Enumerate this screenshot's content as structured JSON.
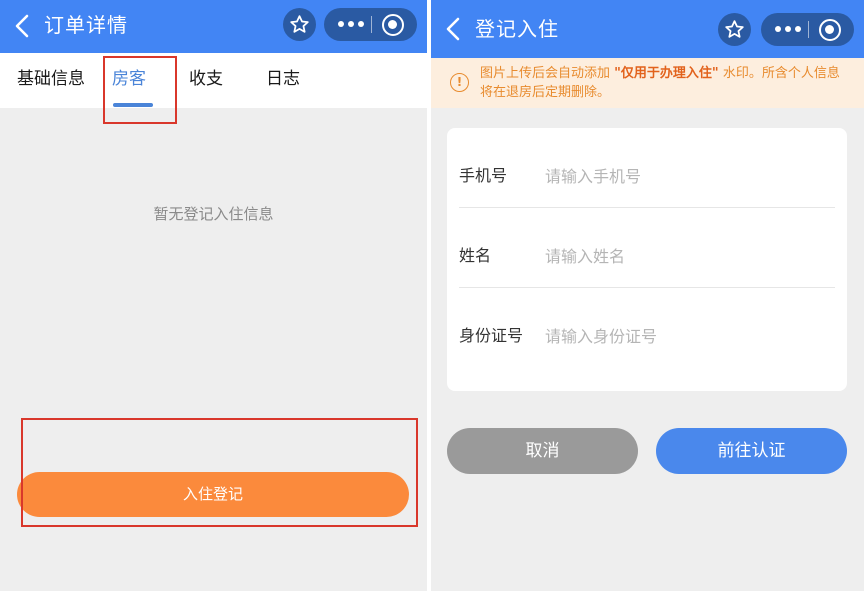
{
  "left": {
    "nav": {
      "title": "订单详情"
    },
    "tabs": [
      {
        "label": "基础信息"
      },
      {
        "label": "房客"
      },
      {
        "label": "收支"
      },
      {
        "label": "日志"
      }
    ],
    "active_tab": "房客",
    "empty_message": "暂无登记入住信息",
    "checkin_button": "入住登记"
  },
  "right": {
    "nav": {
      "title": "登记入住"
    },
    "notice": {
      "prefix": "图片上传后会自动添加 ",
      "highlight": "\"仅用于办理入住\"",
      "suffix": " 水印。所含个人信息将在退房后定期删除。"
    },
    "form": {
      "phone": {
        "label": "手机号",
        "placeholder": "请输入手机号",
        "value": ""
      },
      "name": {
        "label": "姓名",
        "placeholder": "请输入姓名",
        "value": ""
      },
      "id_number": {
        "label": "身份证号",
        "placeholder": "请输入身份证号",
        "value": ""
      }
    },
    "cancel_button": "取消",
    "confirm_button": "前往认证"
  },
  "colors": {
    "nav_blue": "#4285f4",
    "capsule_dark": "#2a5aa3",
    "tab_active": "#4a84d8",
    "orange_button": "#fb8a3c",
    "notice_bg": "#fdeede",
    "notice_text": "#e88b2e",
    "highlight_box": "#d9372b",
    "cancel_gray": "#9a9a9a",
    "confirm_blue": "#4a88ec"
  },
  "icons": [
    "back-arrow-icon",
    "star-icon",
    "more-dots-icon",
    "target-circle-icon",
    "info-icon"
  ]
}
